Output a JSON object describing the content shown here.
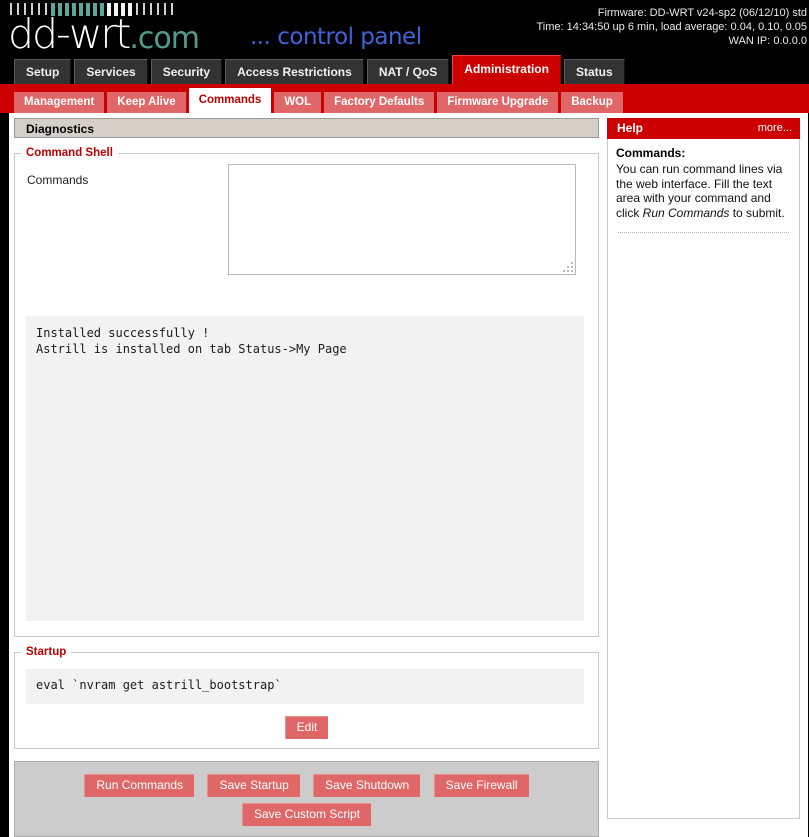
{
  "brand": {
    "logo_main": "dd-wrt",
    "logo_tld": ".com",
    "tagline": "... control panel",
    "led_pattern": [
      "thin",
      "thin",
      "thin",
      "thin",
      "thin",
      "thin",
      "teal",
      "teal",
      "teal",
      "teal",
      "teal",
      "teal",
      "teal",
      "teal",
      "white",
      "white",
      "white",
      "white",
      "thin",
      "thin",
      "thin",
      "thin",
      "thin",
      "thin"
    ],
    "led_teal_color": "#5aa89a",
    "led_white_color": "#f2f2f2"
  },
  "sysinfo": {
    "firmware": "Firmware: DD-WRT v24-sp2 (06/12/10) std",
    "time": "Time: 14:34:50 up 6 min, load average: 0.04, 0.10, 0.05",
    "wan_ip": "WAN IP: 0.0.0.0"
  },
  "main_tabs": [
    {
      "label": "Setup",
      "active": false
    },
    {
      "label": "Services",
      "active": false
    },
    {
      "label": "Security",
      "active": false
    },
    {
      "label": "Access Restrictions",
      "active": false
    },
    {
      "label": "NAT / QoS",
      "active": false
    },
    {
      "label": "Administration",
      "active": true
    },
    {
      "label": "Status",
      "active": false
    }
  ],
  "sub_tabs": [
    {
      "label": "Management",
      "active": false
    },
    {
      "label": "Keep Alive",
      "active": false
    },
    {
      "label": "Commands",
      "active": true
    },
    {
      "label": "WOL",
      "active": false
    },
    {
      "label": "Factory Defaults",
      "active": false
    },
    {
      "label": "Firmware Upgrade",
      "active": false
    },
    {
      "label": "Backup",
      "active": false
    }
  ],
  "page": {
    "section_title": "Diagnostics"
  },
  "command_shell": {
    "legend": "Command Shell",
    "commands_label": "Commands",
    "textarea_value": "",
    "textarea_placeholder": "",
    "console_output": "Installed successfully !\nAstrill is installed on tab Status->My Page"
  },
  "startup": {
    "legend": "Startup",
    "script": "eval `nvram get astrill_bootstrap`",
    "edit_label": "Edit"
  },
  "actions": {
    "run_commands": "Run Commands",
    "save_startup": "Save Startup",
    "save_shutdown": "Save Shutdown",
    "save_firewall": "Save Firewall",
    "save_custom_script": "Save Custom Script"
  },
  "help": {
    "title": "Help",
    "more_label": "more...",
    "heading": "Commands:",
    "body_part1": "You can run command lines via the web interface. Fill the text area with your command and click ",
    "body_emphasis": "Run Commands",
    "body_part2": " to submit."
  },
  "colors": {
    "accent_red": "#cc0000",
    "button_red": "#e06767",
    "header_black": "#000000",
    "panel_grey": "#cccccc",
    "console_grey": "#f2f2f2"
  }
}
